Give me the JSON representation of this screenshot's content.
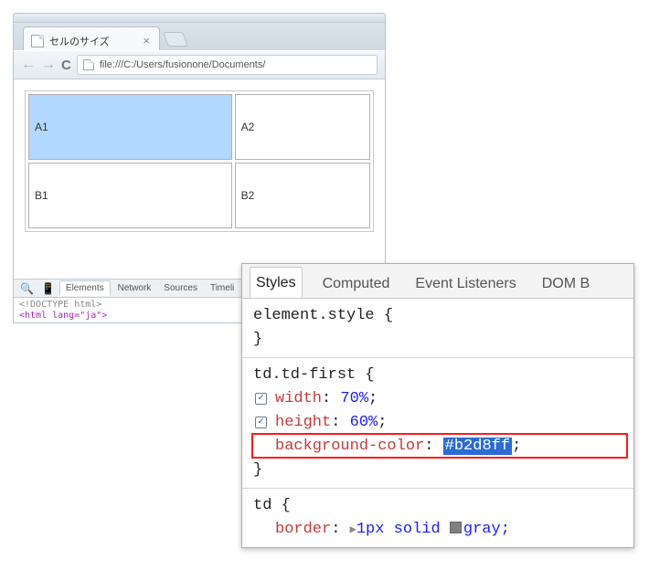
{
  "browser": {
    "tab_title": "セルのサイズ",
    "close_glyph": "×",
    "back_glyph": "←",
    "forward_glyph": "→",
    "reload_glyph": "C",
    "url": "file:///C:/Users/fusionone/Documents/"
  },
  "table": {
    "rows": [
      [
        "A1",
        "A2"
      ],
      [
        "B1",
        "B2"
      ]
    ]
  },
  "devtools_strip": {
    "search_glyph": "🔍",
    "device_glyph": "📱",
    "tabs": [
      "Elements",
      "Network",
      "Sources",
      "Timeli"
    ],
    "active_tab": "Elements",
    "source_line1": "<!DOCTYPE html>",
    "source_line2": "<html lang=\"ja\">",
    "styles_pill": "Styles"
  },
  "styles_panel": {
    "tabs": [
      "Styles",
      "Computed",
      "Event Listeners",
      "DOM B"
    ],
    "active_tab": "Styles",
    "rules": [
      {
        "selector": "element.style",
        "props": []
      },
      {
        "selector": "td.td-first",
        "props": [
          {
            "checked": true,
            "name": "width",
            "value": "70%"
          },
          {
            "checked": true,
            "name": "height",
            "value": "60%"
          },
          {
            "checked": null,
            "name": "background-color",
            "value": "#b2d8ff",
            "selected": true
          }
        ],
        "highlighted_prop_index": 2
      },
      {
        "selector": "td",
        "props": [
          {
            "checked": null,
            "name": "border",
            "value_prefix": "▶",
            "value_text": "1px solid",
            "swatch": "#808080",
            "value_tail": "gray;"
          }
        ],
        "truncated": true
      }
    ]
  }
}
